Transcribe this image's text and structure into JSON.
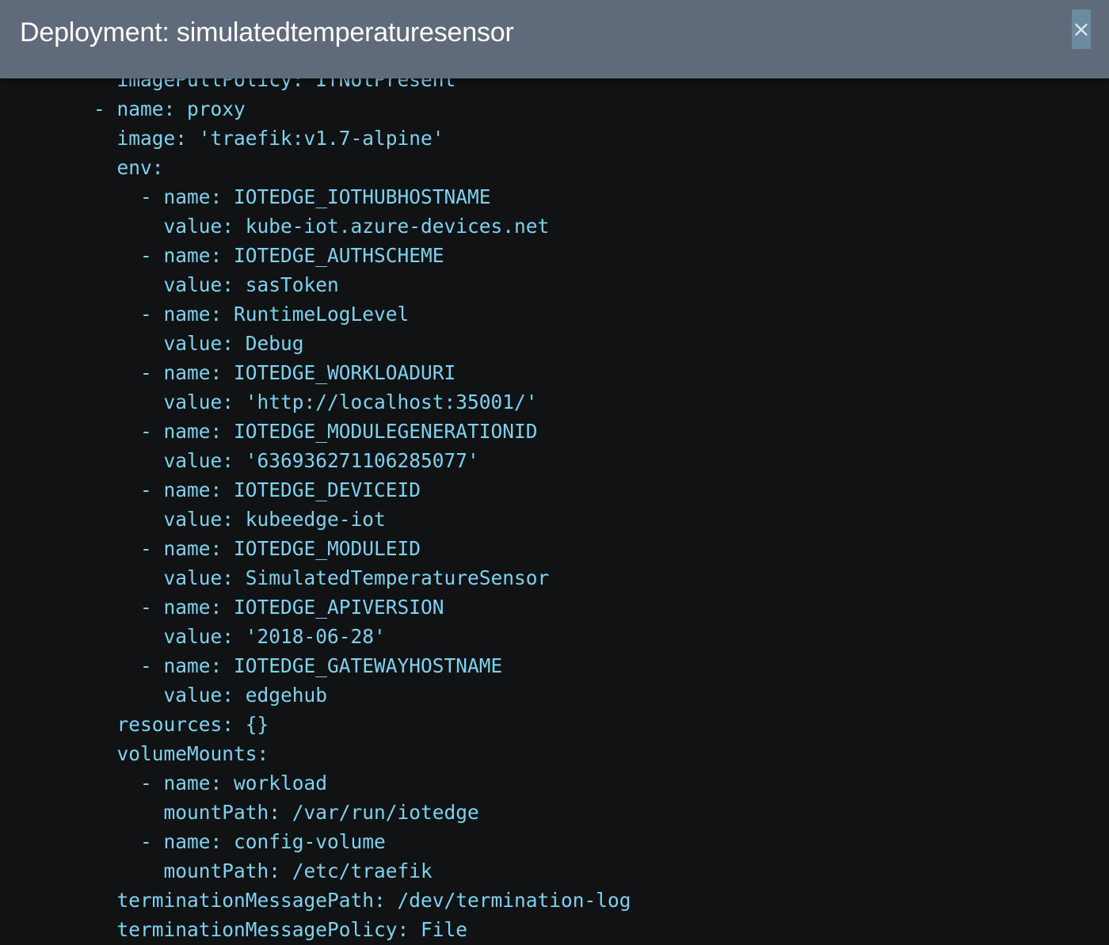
{
  "dialog": {
    "title": "Deployment: simulatedtemperaturesensor",
    "close_label": "×"
  },
  "yaml_lines": [
    "          imagePullPolicy: IfNotPresent",
    "        - name: proxy",
    "          image: 'traefik:v1.7-alpine'",
    "          env:",
    "            - name: IOTEDGE_IOTHUBHOSTNAME",
    "              value: kube-iot.azure-devices.net",
    "            - name: IOTEDGE_AUTHSCHEME",
    "              value: sasToken",
    "            - name: RuntimeLogLevel",
    "              value: Debug",
    "            - name: IOTEDGE_WORKLOADURI",
    "              value: 'http://localhost:35001/'",
    "            - name: IOTEDGE_MODULEGENERATIONID",
    "              value: '636936271106285077'",
    "            - name: IOTEDGE_DEVICEID",
    "              value: kubeedge-iot",
    "            - name: IOTEDGE_MODULEID",
    "              value: SimulatedTemperatureSensor",
    "            - name: IOTEDGE_APIVERSION",
    "              value: '2018-06-28'",
    "            - name: IOTEDGE_GATEWAYHOSTNAME",
    "              value: edgehub",
    "          resources: {}",
    "          volumeMounts:",
    "            - name: workload",
    "              mountPath: /var/run/iotedge",
    "            - name: config-volume",
    "              mountPath: /etc/traefik",
    "          terminationMessagePath: /dev/termination-log",
    "          terminationMessagePolicy: File"
  ]
}
